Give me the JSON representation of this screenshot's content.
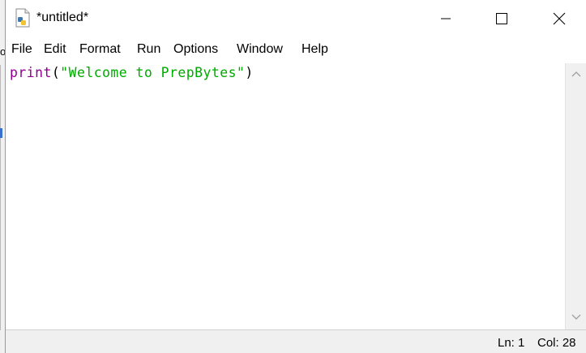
{
  "window": {
    "title": "*untitled*"
  },
  "menu": {
    "items": [
      "File",
      "Edit",
      "Format",
      "Run",
      "Options",
      "Window",
      "Help"
    ]
  },
  "editor": {
    "code": {
      "keyword": "print",
      "open": "(",
      "string": "\"Welcome to PrepBytes\"",
      "close": ")"
    }
  },
  "status": {
    "ln": "Ln: 1",
    "col": "Col: 28"
  },
  "colors": {
    "keyword": "#900090",
    "string": "#00aa00",
    "punct": "#000000"
  },
  "left_window": {
    "glyph": "o"
  }
}
